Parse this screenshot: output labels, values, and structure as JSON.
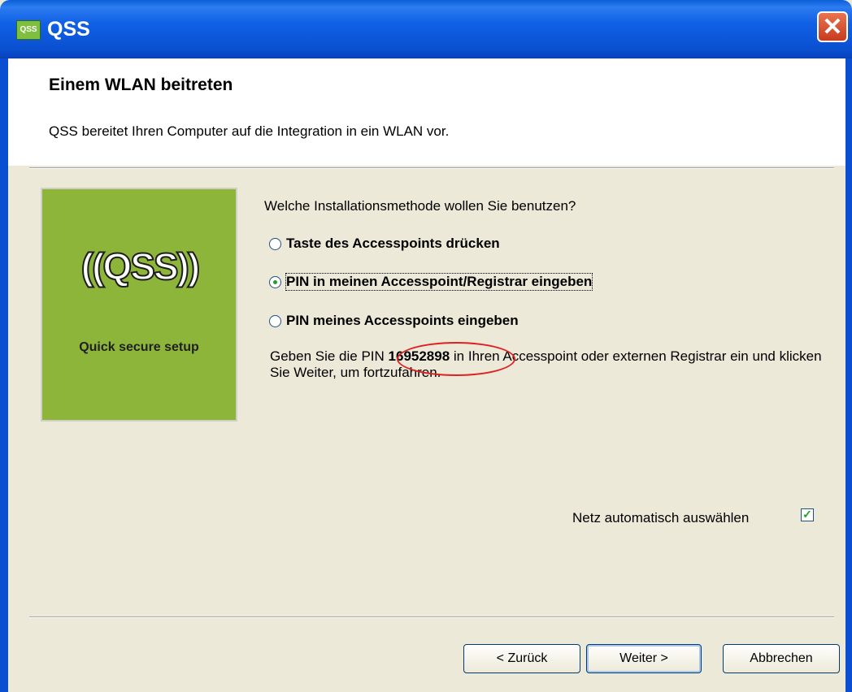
{
  "window": {
    "icon_text": "QSS",
    "title": "QSS",
    "close_label": "✕"
  },
  "header": {
    "title": "Einem WLAN beitreten",
    "subtitle": "QSS bereitet Ihren Computer auf die Integration in ein WLAN vor."
  },
  "logo": {
    "mark": "((QSS))",
    "caption": "Quick secure setup"
  },
  "question": "Welche Installationsmethode wollen Sie benutzen?",
  "options": [
    {
      "label": "Taste des Accesspoints drücken",
      "selected": false
    },
    {
      "label": "PIN in meinen Accesspoint/Registrar eingeben",
      "selected": true
    },
    {
      "label": "PIN meines Accesspoints eingeben",
      "selected": false
    }
  ],
  "info": {
    "before_pin": "Geben Sie die PIN ",
    "pin": "16952898",
    "after_pin": " in Ihren Accesspoint oder externen Registrar ein und klicken Sie Weiter, um fortzufahren."
  },
  "auto_network": {
    "label": "Netz automatisch auswählen",
    "checked": true
  },
  "buttons": {
    "back": "< Zurück",
    "next": "Weiter >",
    "cancel": "Abbrechen"
  },
  "colors": {
    "titlebar": "#0a5fd8",
    "logo_bg": "#8db53a",
    "pin_circle": "#e02020"
  }
}
